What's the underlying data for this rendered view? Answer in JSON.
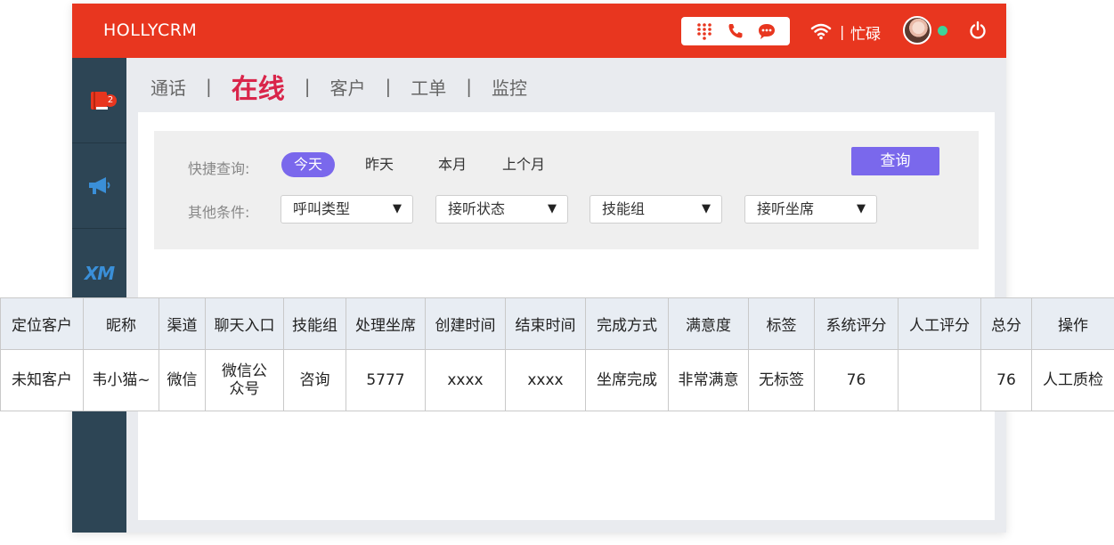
{
  "app": {
    "brand": "HOLLYCRM"
  },
  "header": {
    "icons": [
      "dialpad-icon",
      "phone-icon",
      "chat-icon"
    ],
    "status_separator": "|",
    "status": "忙碌"
  },
  "sidebar": {
    "badge_count": "2",
    "items": [
      "book-icon",
      "megaphone-icon",
      "xm-logo"
    ],
    "logo_text": "XM"
  },
  "nav": {
    "items": [
      "通话",
      "在线",
      "客户",
      "工单",
      "监控"
    ],
    "separator": "|",
    "active_index": 1
  },
  "filters": {
    "quick_label": "快捷查询:",
    "quick_options": [
      "今天",
      "昨天",
      "本月",
      "上个月"
    ],
    "quick_active": "今天",
    "other_label": "其他条件:",
    "selects": [
      "呼叫类型",
      "接听状态",
      "技能组",
      "接听坐席"
    ],
    "dropdown_glyph": "▼",
    "query_button": "查询"
  },
  "table": {
    "columns": [
      "定位客户",
      "昵称",
      "渠道",
      "聊天入口",
      "技能组",
      "处理坐席",
      "创建时间",
      "结束时间",
      "完成方式",
      "满意度",
      "标签",
      "系统评分",
      "人工评分",
      "总分",
      "操作"
    ],
    "rows": [
      [
        "未知客户",
        "韦小猫~",
        "微信",
        "微信公众号",
        "咨询",
        "5777",
        "xxxx",
        "xxxx",
        "坐席完成",
        "非常满意",
        "无标签",
        "76",
        "",
        "76",
        "人工质检"
      ]
    ]
  },
  "colors": {
    "header": "#e8361f",
    "sidebar": "#2d4555",
    "accent": "#7a68ec",
    "nav_active": "#d9254a",
    "online_dot": "#3ed39a"
  }
}
